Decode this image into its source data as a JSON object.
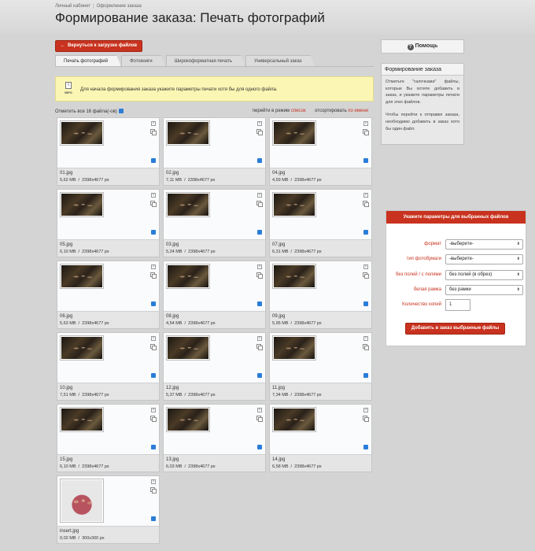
{
  "breadcrumbs": [
    "Личный кабинет",
    "Оформление заказа"
  ],
  "page_title": "Формирование заказа: Печать фотографий",
  "back_button": "Вернуться к загрузке файлов",
  "tabs": [
    {
      "label": "Печать фотографий",
      "active": true
    },
    {
      "label": "Фотокниги",
      "active": false
    },
    {
      "label": "Широкоформатная печать",
      "active": false
    },
    {
      "label": "Универсальный заказ",
      "active": false
    }
  ],
  "info": {
    "icon_label": "INFO",
    "text": "Для начала формирования заказа укажите параметры печати хотя бы для одного файла."
  },
  "selection": {
    "select_all": "Отметить все 16 файла(-ов)",
    "mode_prefix": "перейти в режим",
    "mode_link": "список",
    "sort_prefix": "отсортировать",
    "sort_link": "по имени"
  },
  "files": [
    {
      "name": "01.jpg",
      "size": "5,62 MB",
      "dims": "2398x4677 px"
    },
    {
      "name": "02.jpg",
      "size": "7,11 MB",
      "dims": "2398x4677 px"
    },
    {
      "name": "04.jpg",
      "size": "4,59 MB",
      "dims": "2398x4677 px"
    },
    {
      "name": "05.jpg",
      "size": "6,10 MB",
      "dims": "2398x4677 px"
    },
    {
      "name": "03.jpg",
      "size": "5,24 MB",
      "dims": "2398x4677 px"
    },
    {
      "name": "07.jpg",
      "size": "6,31 MB",
      "dims": "2398x4677 px"
    },
    {
      "name": "06.jpg",
      "size": "5,63 MB",
      "dims": "2398x4677 px"
    },
    {
      "name": "08.jpg",
      "size": "4,54 MB",
      "dims": "2398x4677 px"
    },
    {
      "name": "09.jpg",
      "size": "5,95 MB",
      "dims": "2398x4677 px"
    },
    {
      "name": "10.jpg",
      "size": "7,51 MB",
      "dims": "2398x4677 px"
    },
    {
      "name": "12.jpg",
      "size": "5,37 MB",
      "dims": "2398x4677 px"
    },
    {
      "name": "11.jpg",
      "size": "7,34 MB",
      "dims": "2398x4677 px"
    },
    {
      "name": "15.jpg",
      "size": "6,10 MB",
      "dims": "2398x4677 px"
    },
    {
      "name": "13.jpg",
      "size": "6,03 MB",
      "dims": "2398x4677 px"
    },
    {
      "name": "14.jpg",
      "size": "6,58 MB",
      "dims": "2398x4677 px"
    },
    {
      "name": "insert.jpg",
      "size": "0,02 MB",
      "dims": "300x300 px"
    }
  ],
  "help": {
    "icon": "?",
    "label": "Помощь"
  },
  "sidebar": {
    "title": "Формирование заказа",
    "p1": "Отметьте \"галочками\" файлы, которые Вы хотите добавить в заказ, и укажите параметры печати для этих файлов.",
    "p2": "Чтобы перейти к отправке заказа, необходимо добавить в заказ хотя бы один файл."
  },
  "form": {
    "title": "Укажите параметры для выбранных файлов",
    "format_label": "формат",
    "format_value": "-выберите-",
    "paper_label": "тип фотобумаги",
    "paper_value": "-выберите-",
    "margins_label": "без полей / с полями",
    "margins_value": "без полей (в обрез)",
    "frame_label": "белая рамка",
    "frame_value": "без рамки",
    "copies_label": "Количество копий",
    "copies_value": "1",
    "submit": "Добавить в заказ выбранные файлы"
  },
  "colors": {
    "accent": "#c8321e",
    "checkbox": "#2a7dd8",
    "info_bg": "#fbf6b3"
  }
}
